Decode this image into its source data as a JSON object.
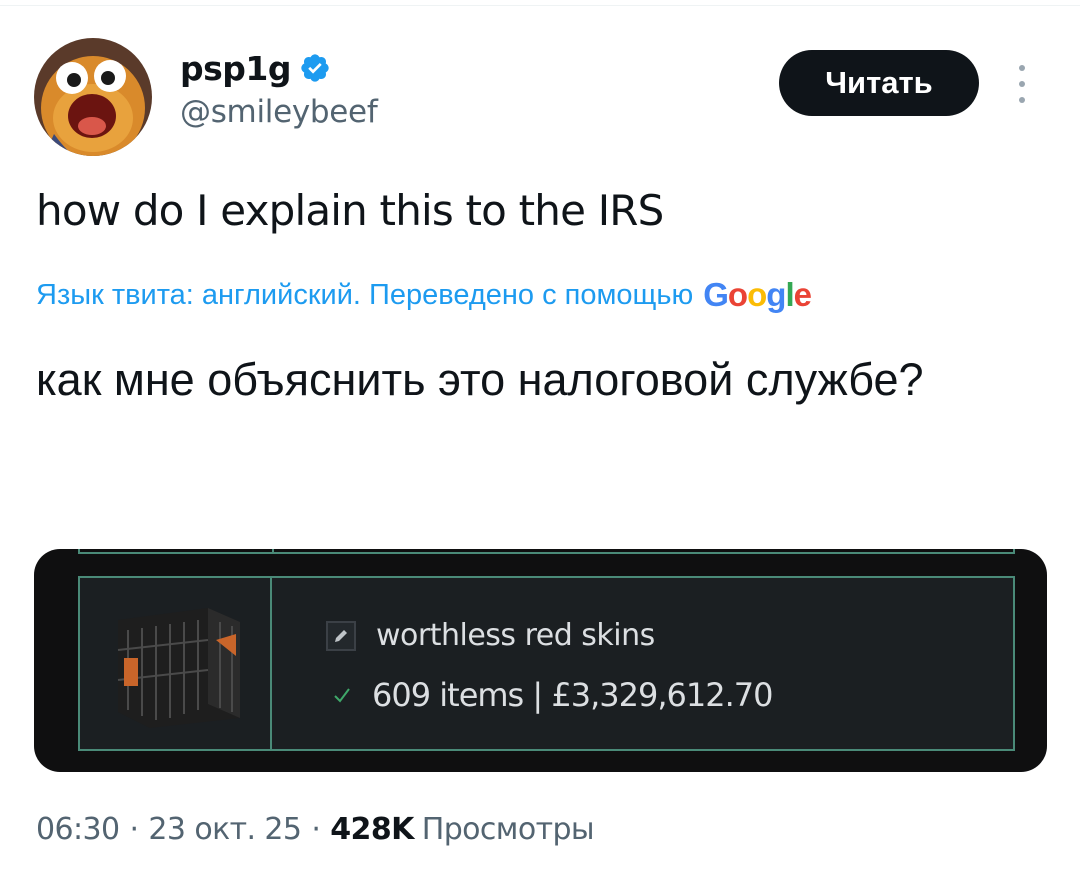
{
  "author": {
    "display_name": "psp1g",
    "handle": "@smileybeef",
    "verified": true,
    "avatar_icon": "cartoon-creature-avatar"
  },
  "actions": {
    "follow_label": "Читать",
    "more_icon": "vertical-ellipsis-icon"
  },
  "tweet": {
    "text": "how do I explain this to the IRS",
    "translation_info": "Язык твита: английский. Переведено с помощью",
    "translation_provider": "Google",
    "translated_text": "как мне объяснить это налоговой службе?"
  },
  "media": {
    "inventory_name": "worthless red skins",
    "inventory_stats": "609 items | £3,329,612.70",
    "item_icon": "weapon-case-icon"
  },
  "meta": {
    "time": "06:30",
    "date": "23 окт. 25",
    "views_count": "428K",
    "views_label": "Просмотры",
    "separator": "·"
  },
  "colors": {
    "link_blue": "#1d9bf0",
    "verified_blue": "#1d9bf0",
    "secondary_text": "#536471",
    "panel_border": "#4a8a78",
    "google_blue": "#4285f4",
    "google_red": "#ea4335",
    "google_yellow": "#fbbc05",
    "google_green": "#34a853"
  }
}
